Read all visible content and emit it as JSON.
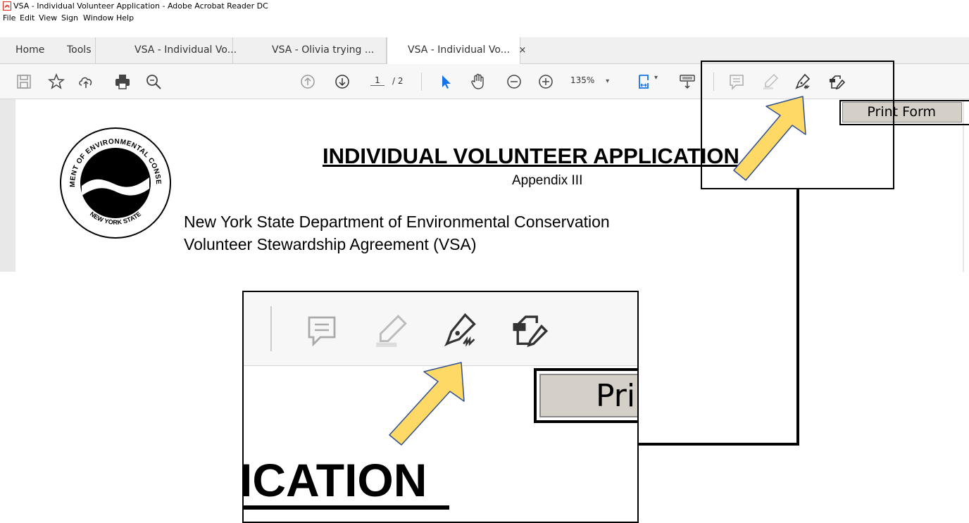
{
  "window": {
    "title": "VSA - Individual Volunteer Application  - Adobe Acrobat Reader DC"
  },
  "menu": {
    "items": [
      "File",
      "Edit",
      "View",
      "Sign",
      "Window",
      "Help"
    ]
  },
  "tabs": {
    "home": "Home",
    "tools": "Tools",
    "docs": [
      "VSA - Individual Vo...",
      "VSA - Olivia trying ...",
      "VSA - Individual Vo..."
    ],
    "close_glyph": "×"
  },
  "toolbar": {
    "page_current": "1",
    "page_total": "/ 2",
    "zoom": "135%",
    "zoom_caret": "▾"
  },
  "document": {
    "title": "INDIVIDUAL VOLUNTEER APPLICATION",
    "subtitle": "Appendix III",
    "org_line1": "New York State Department of Environmental Conservation",
    "org_line2": "Volunteer Stewardship Agreement (VSA)",
    "seal_top": "DEPARTMENT OF ENVIRONMENTAL CONSERVATION",
    "seal_bottom": "NEW YORK STATE",
    "print_button": "Print Form"
  },
  "zoom_inset": {
    "print_button": "Prir",
    "title_fragment": "ICATION"
  },
  "colors": {
    "arrow_fill": "#FFD966",
    "arrow_stroke": "#2F4F8F",
    "select_blue": "#1473E6",
    "pdf_red": "#D9251C"
  },
  "icons": [
    "pdf-icon",
    "save-icon",
    "bookmark-star-icon",
    "upload-cloud-icon",
    "print-icon",
    "zoom-search-icon",
    "page-up-icon",
    "page-down-icon",
    "select-arrow-icon",
    "hand-icon",
    "zoom-out-icon",
    "zoom-in-icon",
    "fit-page-icon",
    "keyboard-scroll-icon",
    "comment-icon",
    "highlight-icon",
    "fill-sign-icon",
    "edit-pdf-icon"
  ]
}
